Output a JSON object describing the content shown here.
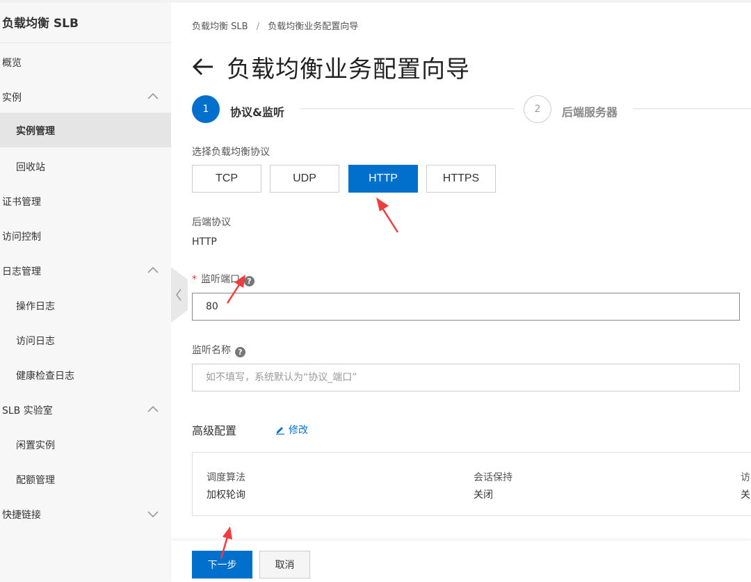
{
  "sidebar": {
    "title": "负载均衡 SLB",
    "items": [
      {
        "label": "概览"
      },
      {
        "label": "实例"
      },
      {
        "label": "实例管理"
      },
      {
        "label": "回收站"
      },
      {
        "label": "证书管理"
      },
      {
        "label": "访问控制"
      },
      {
        "label": "日志管理"
      },
      {
        "label": "操作日志"
      },
      {
        "label": "访问日志"
      },
      {
        "label": "健康检查日志"
      },
      {
        "label": "SLB 实验室"
      },
      {
        "label": "闲置实例"
      },
      {
        "label": "配额管理"
      },
      {
        "label": "快捷链接"
      }
    ]
  },
  "breadcrumb": {
    "root": "负载均衡 SLB",
    "separator": "/",
    "current": "负载均衡业务配置向导"
  },
  "page": {
    "title": "负载均衡业务配置向导"
  },
  "steps": [
    {
      "number": "1",
      "label": "协议&监听",
      "state": "active"
    },
    {
      "number": "2",
      "label": "后端服务器",
      "state": "pending"
    }
  ],
  "form": {
    "protocol_label": "选择负载均衡协议",
    "protocols": [
      "TCP",
      "UDP",
      "HTTP",
      "HTTPS"
    ],
    "selected_protocol": "HTTP",
    "backend_protocol_label": "后端协议",
    "backend_protocol_value": "HTTP",
    "required_mark": "*",
    "port_label": "监听端口",
    "port_value": "80",
    "name_label": "监听名称",
    "name_placeholder": "如不填写，系统默认为“协议_端口”",
    "help_glyph": "?"
  },
  "advanced": {
    "title": "高级配置",
    "edit_label": "修改",
    "items": [
      {
        "key": "调度算法",
        "value": "加权轮询"
      },
      {
        "key": "会话保持",
        "value": "关闭"
      },
      {
        "key": "访",
        "value": "关"
      }
    ]
  },
  "footer": {
    "next_label": "下一步",
    "cancel_label": "取消"
  },
  "colors": {
    "primary": "#0070cc",
    "annotation_arrow": "#f03c3c",
    "sidebar_bg": "#f7f7f7"
  }
}
